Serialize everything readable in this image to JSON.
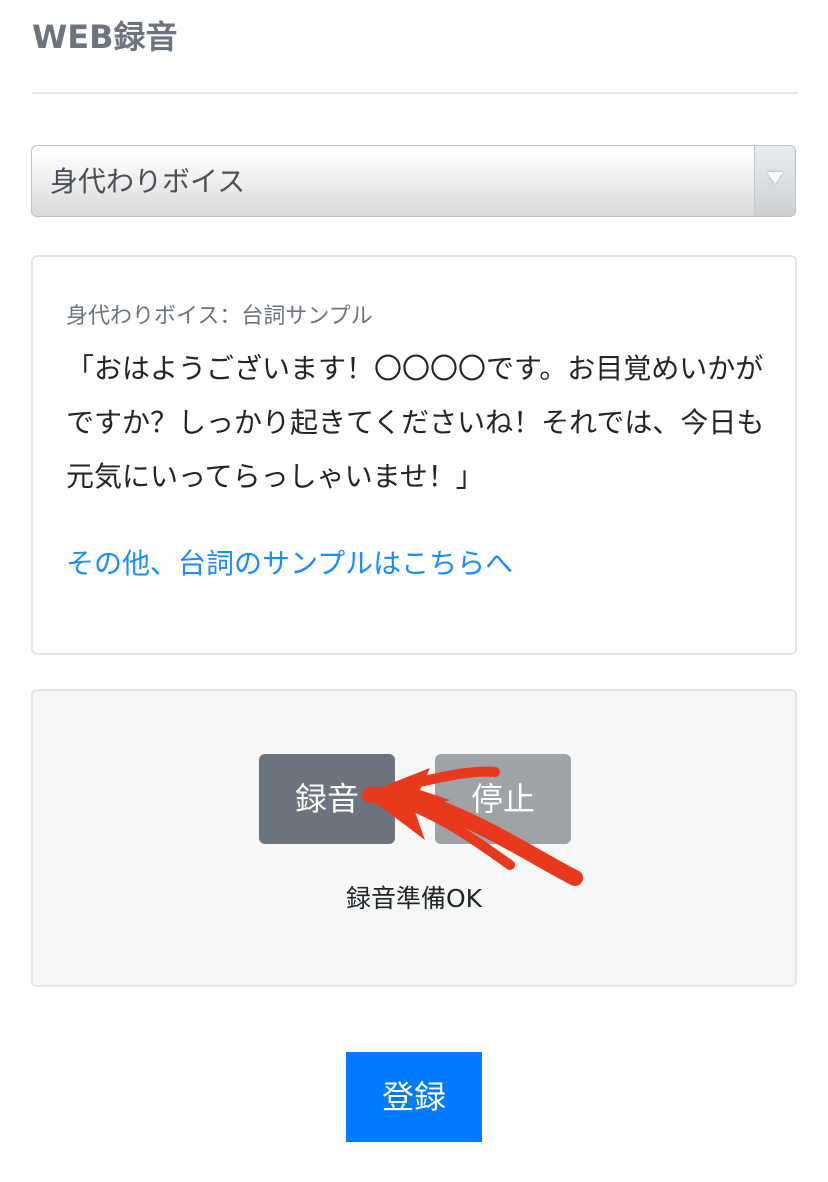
{
  "header": {
    "title": "WEB録音"
  },
  "voice_select": {
    "selected": "身代わりボイス"
  },
  "sample": {
    "label": "身代わりボイス：台詞サンプル",
    "text": "「おはようございます！〇〇〇〇です。お目覚めいかがですか？しっかり起きてくださいね！それでは、今日も元気にいってらっしゃいませ！」",
    "link_text": "その他、台詞のサンプルはこちらへ"
  },
  "recorder": {
    "record_label": "録音",
    "stop_label": "停止",
    "status": "録音準備OK"
  },
  "footer": {
    "register_label": "登録"
  },
  "colors": {
    "title_gray": "#6c757d",
    "link_blue": "#1a8cff",
    "primary_blue": "#007bff",
    "annotation_red": "#e8391d"
  }
}
